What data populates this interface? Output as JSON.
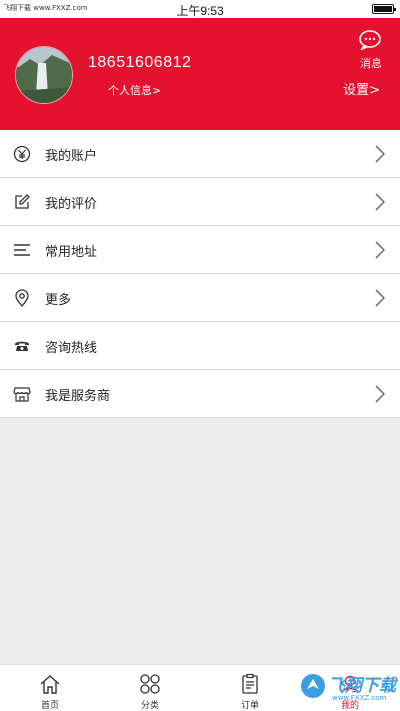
{
  "status_bar": {
    "carrier_text": "飞翔下载 www.FXXZ.com",
    "time": "上午9:53"
  },
  "header": {
    "phone": "18651606812",
    "profile_link": "个人信息>",
    "message_label": "消息",
    "settings_link": "设置>",
    "background_color": "#e5122f"
  },
  "menu": {
    "items": [
      {
        "label": "我的账户",
        "icon": "yen-icon",
        "chevron": true
      },
      {
        "label": "我的评价",
        "icon": "edit-icon",
        "chevron": true
      },
      {
        "label": "常用地址",
        "icon": "list-icon",
        "chevron": true
      },
      {
        "label": "更多",
        "icon": "location-pin-icon",
        "chevron": true
      },
      {
        "label": "咨询热线",
        "icon": "phone-icon",
        "chevron": false
      },
      {
        "label": "我是服务商",
        "icon": "store-icon",
        "chevron": true
      }
    ]
  },
  "tabbar": {
    "tabs": [
      {
        "label": "首页",
        "icon": "home-icon"
      },
      {
        "label": "分类",
        "icon": "category-icon"
      },
      {
        "label": "订单",
        "icon": "order-icon"
      },
      {
        "label": "我的",
        "icon": "profile-icon",
        "active": true
      }
    ]
  },
  "watermark": {
    "main": "飞翔下载",
    "sub": "www.FXXZ.com"
  }
}
